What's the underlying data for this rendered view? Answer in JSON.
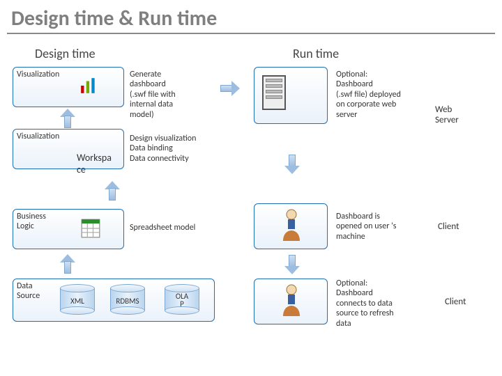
{
  "title": "Design time & Run time",
  "columns": {
    "design": "Design time",
    "run": "Run time"
  },
  "design": {
    "visualization1": "Visualization",
    "visualization2": "Visualization",
    "workspace": "Workspa\nce",
    "business_logic": "Business\nLogic",
    "data_source": "Data\nSource",
    "generate_desc": "Generate\ndashboard\n(.swf file with\ninternal data\nmodel)",
    "workspace_desc": "Design visualization\nData binding\nData connectivity",
    "spreadsheet_desc": "Spreadsheet model",
    "cyl_xml": "XML",
    "cyl_rdbms": "RDBMS",
    "cyl_olap": "OLA\nP"
  },
  "run": {
    "step1_desc": "Optional:\nDashboard\n(.swf file) deployed\non corporate web\nserver",
    "step1_side": "Web\nServer",
    "step2_desc": "Dashboard is\nopened on user 's\nmachine",
    "step2_side": "Client",
    "step3_desc": "Optional:\nDashboard\nconnects to data\nsource to refresh\ndata",
    "step3_side": "Client"
  }
}
